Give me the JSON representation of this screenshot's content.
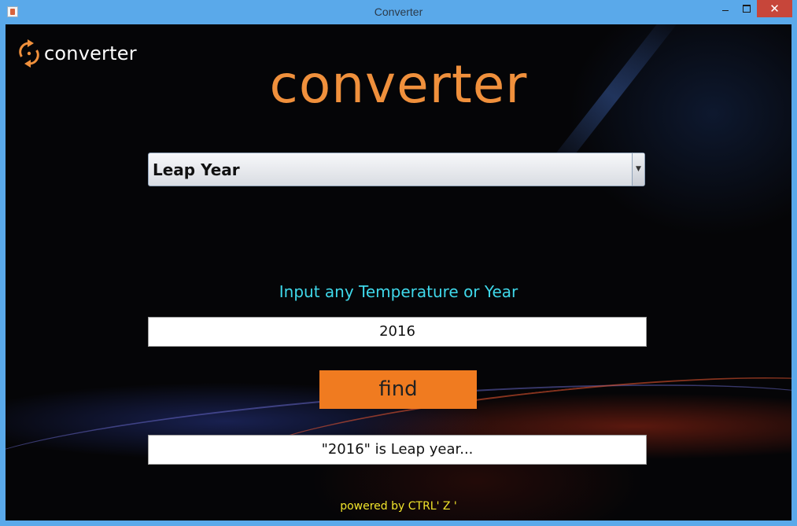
{
  "window": {
    "title": "Converter",
    "close_glyph": "✕"
  },
  "logo": {
    "icon": "refresh-cycle-icon",
    "text": "converter"
  },
  "heading": "converter",
  "converter_select": {
    "selected": "Leap Year",
    "arrow_glyph": "▼"
  },
  "prompt": "Input any Temperature or Year",
  "input": {
    "value": "2016"
  },
  "find_button": "find",
  "result": {
    "value": "\"2016\" is Leap year..."
  },
  "footer": "powered by CTRL' Z '",
  "colors": {
    "titlebar": "#5aa9ea",
    "accent_orange": "#f07b20",
    "heading_orange": "#f0903c",
    "prompt_cyan": "#3fd8ea",
    "footer_yellow": "#f2e52b",
    "close_red": "#c7463a"
  }
}
